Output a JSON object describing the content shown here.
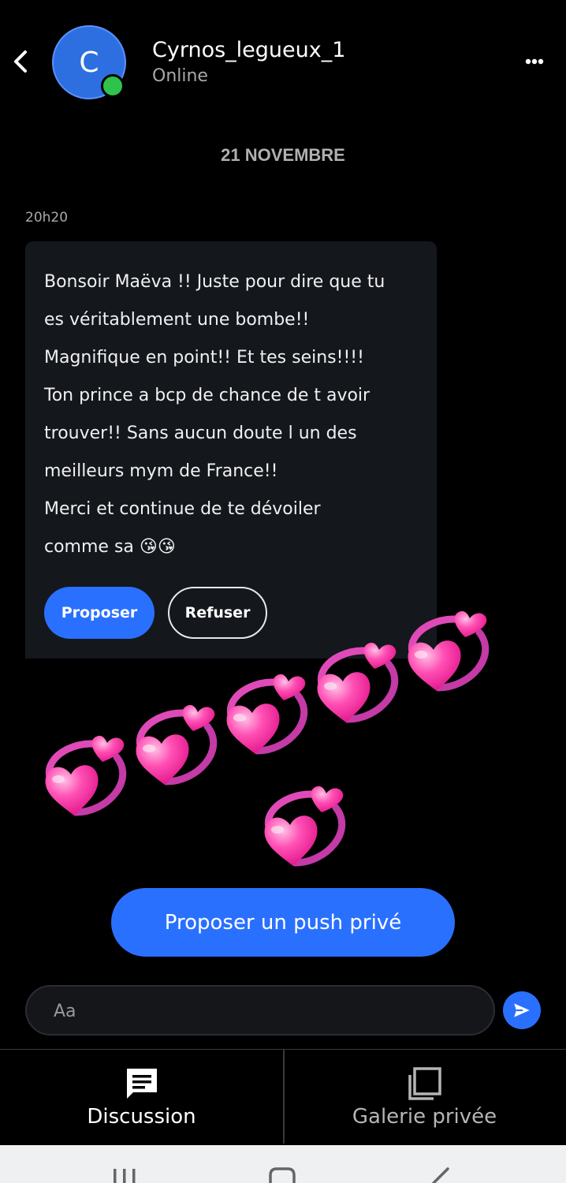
{
  "header": {
    "avatar_initial": "C",
    "username": "Cyrnos_legueux_1",
    "status": "Online"
  },
  "conversation": {
    "date_separator": "21 NOVEMBRE",
    "message": {
      "time": "20h20",
      "lines": [
        "Bonsoir Maëva !! Juste pour dire que tu",
        "es véritablement une bombe!!",
        "Magnifique en point!! Et tes seins!!!!",
        "Ton prince a bcp de chance de t avoir",
        "trouver!! Sans aucun doute l un des",
        "meilleurs mym de France!!",
        "Merci et continue de te dévoiler",
        "comme sa 😘😘"
      ],
      "accept_label": "Proposer",
      "refuse_label": "Refuser"
    },
    "sticker": "revolving-hearts-emoji"
  },
  "push_button_label": "Proposer un push privé",
  "composer": {
    "placeholder": "Aa"
  },
  "tabs": [
    {
      "label": "Discussion",
      "icon": "chat-icon",
      "active": true
    },
    {
      "label": "Galerie privée",
      "icon": "gallery-icon",
      "active": false
    }
  ],
  "colors": {
    "accent": "#2a70ff",
    "online": "#2fc34b",
    "bubble": "#14171c",
    "background": "#000000"
  }
}
